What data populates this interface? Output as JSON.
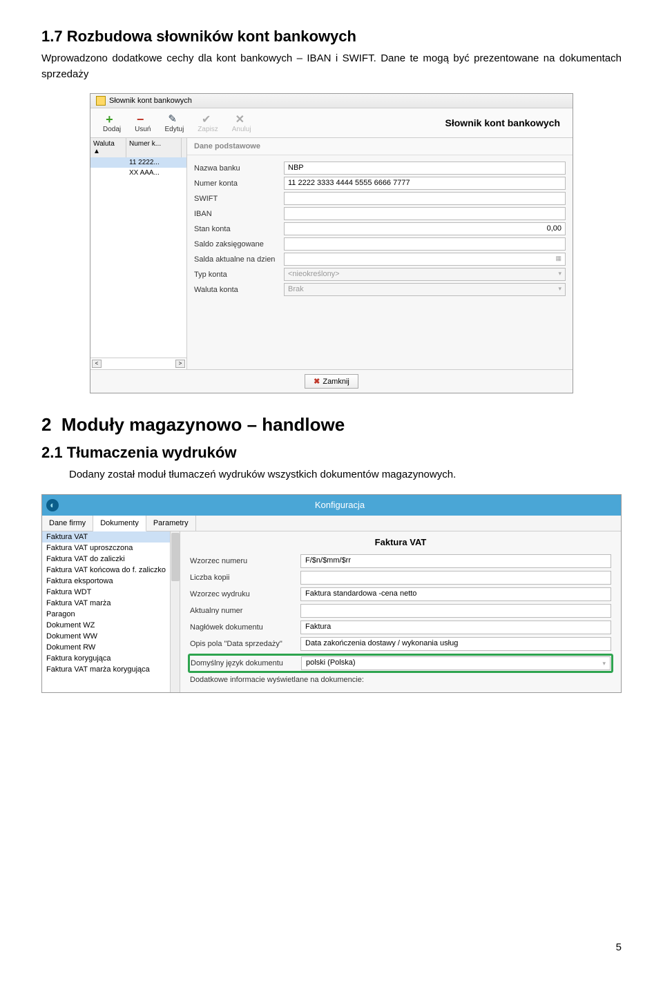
{
  "section1": {
    "number": "1.7",
    "title": "Rozbudowa słowników kont bankowych",
    "body": "Wprowadzono dodatkowe cechy dla kont bankowych – IBAN i SWIFT. Dane te mogą być prezentowane na dokumentach sprzedaży"
  },
  "dialog1": {
    "windowTitle": "Słownik kont bankowych",
    "toolbar": {
      "add": "Dodaj",
      "del": "Usuń",
      "edit": "Edytuj",
      "save": "Zapisz",
      "cancel": "Anuluj"
    },
    "rightTitle": "Słownik kont bankowych",
    "leftCols": {
      "a": "Waluta",
      "asort": "▲",
      "b": "Numer k..."
    },
    "rows": [
      {
        "a": "",
        "b": "11 2222..."
      },
      {
        "a": "",
        "b": "XX AAA..."
      }
    ],
    "tab": "Dane podstawowe",
    "fields": {
      "bank": {
        "label": "Nazwa banku",
        "value": "NBP"
      },
      "acct": {
        "label": "Numer konta",
        "value": "11 2222 3333 4444 5555 6666 7777"
      },
      "swift": {
        "label": "SWIFT",
        "value": ""
      },
      "iban": {
        "label": "IBAN",
        "value": ""
      },
      "balance": {
        "label": "Stan konta",
        "value": "0,00"
      },
      "booked": {
        "label": "Saldo zaksięgowane",
        "value": ""
      },
      "date": {
        "label": "Salda aktualne na dzien",
        "value": ""
      },
      "type": {
        "label": "Typ konta",
        "value": "<nieokreślony>"
      },
      "currency": {
        "label": "Waluta konta",
        "value": "Brak"
      }
    },
    "close": "Zamknij"
  },
  "section2": {
    "number": "2",
    "title": "Moduły magazynowo – handlowe",
    "subnumber": "2.1",
    "subtitle": "Tłumaczenia wydruków",
    "body": "Dodany został moduł tłumaczeń wydruków wszystkich dokumentów magazynowych."
  },
  "dialog2": {
    "windowTitle": "Konfiguracja",
    "tabs": [
      "Dane firmy",
      "Dokumenty",
      "Parametry"
    ],
    "activeTab": 1,
    "leftItems": [
      "Faktura VAT",
      "Faktura VAT uproszczona",
      "Faktura VAT do zaliczki",
      "Faktura VAT końcowa do f. zaliczko",
      "Faktura eksportowa",
      "Faktura WDT",
      "Faktura VAT marża",
      "Paragon",
      "Dokument WZ",
      "Dokument WW",
      "Dokument RW",
      "Faktura korygująca",
      "Faktura VAT marża korygująca"
    ],
    "selectedLeft": 0,
    "rightTitle": "Faktura VAT",
    "fields": {
      "pattern": {
        "label": "Wzorzec numeru",
        "value": "F/$n/$mm/$rr"
      },
      "copies": {
        "label": "Liczba kopii",
        "value": ""
      },
      "template": {
        "label": "Wzorzec wydruku",
        "value": "Faktura standardowa -cena netto"
      },
      "curnum": {
        "label": "Aktualny numer",
        "value": ""
      },
      "header": {
        "label": "Nagłówek dokumentu",
        "value": "Faktura"
      },
      "saleDateDesc": {
        "label": "Opis pola \"Data sprzedaży\"",
        "value": "Data zakończenia dostawy / wykonania usług"
      },
      "lang": {
        "label": "Domyślny język dokumentu",
        "value": "polski (Polska)"
      },
      "extra": {
        "label": "Dodatkowe informacie wyświetlane na dokumencie:"
      }
    }
  },
  "pageNumber": "5"
}
